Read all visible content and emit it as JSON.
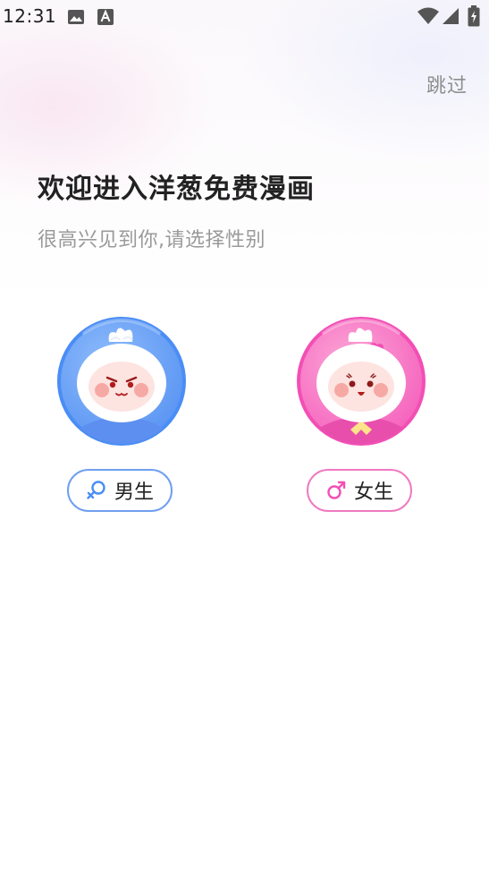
{
  "status_bar": {
    "time": "12:31",
    "icons": [
      "image-icon",
      "text-icon",
      "wifi-icon",
      "signal-icon",
      "battery-charging-icon"
    ]
  },
  "header": {
    "skip_label": "跳过"
  },
  "main": {
    "title": "欢迎进入洋葱免费漫画",
    "subtitle": "很高兴见到你,请选择性别"
  },
  "gender": {
    "male": {
      "label": "男生",
      "icon": "female-symbol-icon",
      "avatar": "boy-onion-avatar",
      "accent": "#4a8df5"
    },
    "female": {
      "label": "女生",
      "icon": "male-symbol-icon",
      "avatar": "girl-onion-avatar",
      "accent": "#f24fb5"
    }
  }
}
